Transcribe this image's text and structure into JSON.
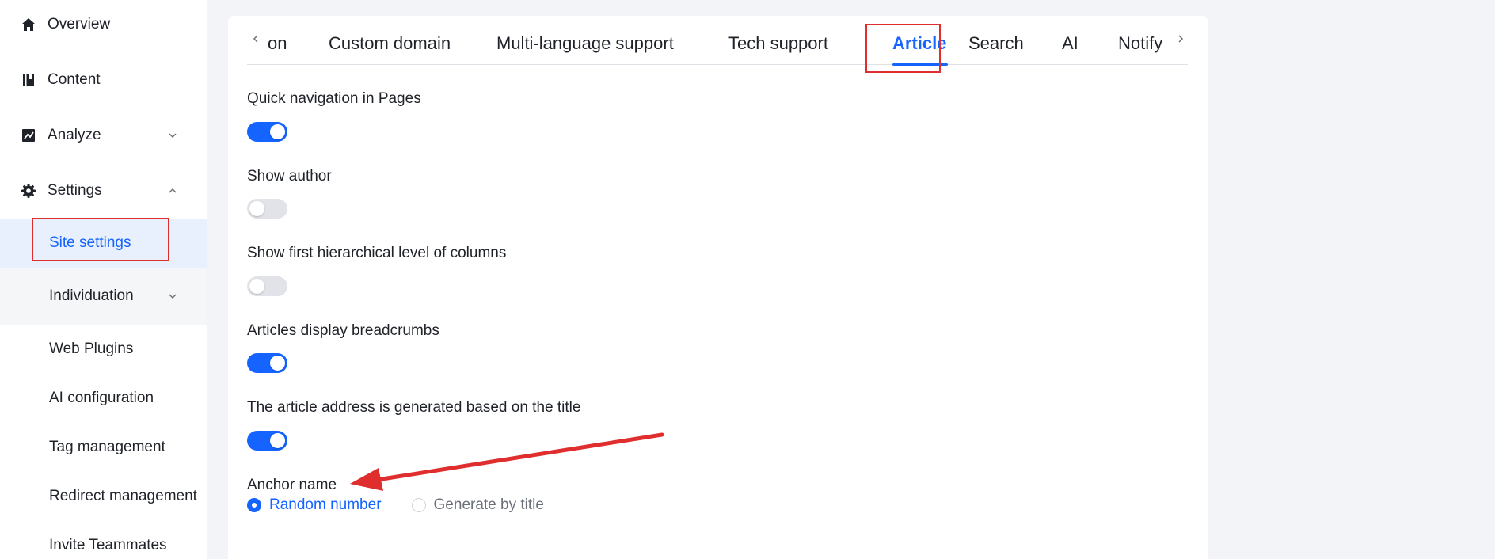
{
  "sidebar": {
    "items": [
      {
        "label": "Overview",
        "icon": "home-icon"
      },
      {
        "label": "Content",
        "icon": "book-icon"
      },
      {
        "label": "Analyze",
        "icon": "chart-icon"
      },
      {
        "label": "Settings",
        "icon": "gear-icon"
      }
    ],
    "sub_items": [
      {
        "label": "Site settings"
      },
      {
        "label": "Individuation"
      },
      {
        "label": "Web Plugins"
      },
      {
        "label": "AI configuration"
      },
      {
        "label": "Tag management"
      },
      {
        "label": "Redirect management"
      },
      {
        "label": "Invite Teammates"
      }
    ]
  },
  "tabs": {
    "items": [
      {
        "label": "on"
      },
      {
        "label": "Custom domain"
      },
      {
        "label": "Multi-language support"
      },
      {
        "label": "Tech support"
      },
      {
        "label": "Article"
      },
      {
        "label": "Search"
      },
      {
        "label": "AI"
      },
      {
        "label": "Notify"
      }
    ],
    "active": "Article"
  },
  "settings": [
    {
      "label": "Quick navigation in Pages",
      "enabled": true
    },
    {
      "label": "Show author",
      "enabled": false
    },
    {
      "label": "Show first hierarchical level of columns",
      "enabled": false
    },
    {
      "label": "Articles display breadcrumbs",
      "enabled": true
    },
    {
      "label": "The article address is generated based on the title",
      "enabled": true
    }
  ],
  "anchor": {
    "label": "Anchor name",
    "options": [
      {
        "label": "Random number",
        "selected": true
      },
      {
        "label": "Generate by title",
        "selected": false
      }
    ]
  },
  "colors": {
    "accent": "#1664ff",
    "highlight": "#e02d2d"
  }
}
